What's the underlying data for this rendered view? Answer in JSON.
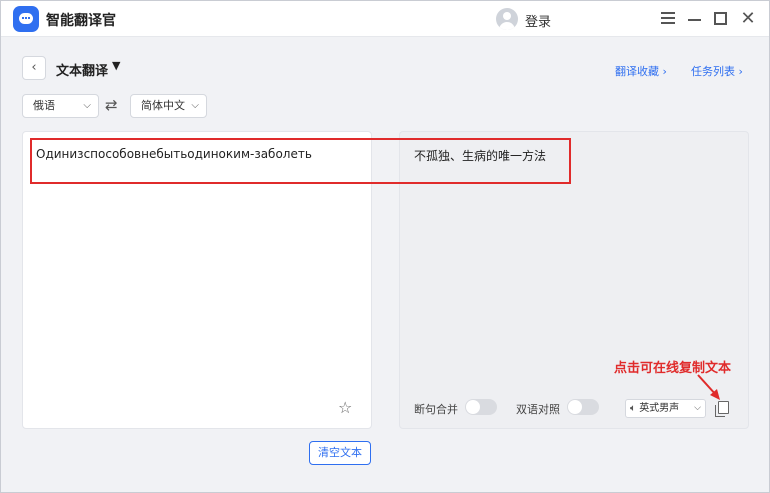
{
  "app": {
    "title": "智能翻译官",
    "login_label": "登录"
  },
  "header": {
    "mode_title": "文本翻译",
    "link_favorites": "翻译收藏 ›",
    "link_tasks": "任务列表 ›"
  },
  "languages": {
    "source": "俄语",
    "target": "简体中文"
  },
  "source_panel": {
    "text": "Одинизспособовнебытьодиноким-заболеть"
  },
  "target_panel": {
    "text": "不孤独、生病的唯一方法",
    "option_merge": "断句合并",
    "option_bilingual": "双语对照",
    "voice": "英式男声"
  },
  "annotation": {
    "text": "点击可在线复制文本",
    "color": "#e02b2b"
  },
  "actions": {
    "clear_label": "清空文本"
  },
  "colors": {
    "accent": "#2f6ff0",
    "highlight": "#e02b2b"
  }
}
